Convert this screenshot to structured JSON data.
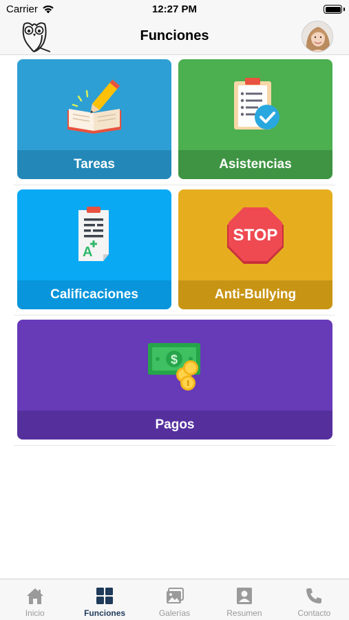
{
  "status_bar": {
    "carrier": "Carrier",
    "time": "12:27 PM"
  },
  "nav": {
    "title": "Funciones"
  },
  "tiles": [
    {
      "label": "Tareas",
      "icon": "notebook-pencil-icon"
    },
    {
      "label": "Asistencias",
      "icon": "clipboard-check-icon"
    },
    {
      "label": "Calificaciones",
      "icon": "graded-paper-icon"
    },
    {
      "label": "Anti-Bullying",
      "icon": "stop-sign-icon"
    },
    {
      "label": "Pagos",
      "icon": "money-coins-icon"
    }
  ],
  "colors": {
    "tareas": "#2e9fd4",
    "asistencias": "#4caf50",
    "calificaciones": "#09a9f4",
    "anti_bullying": "#e6ae1e",
    "pagos": "#673ab7",
    "tab_active": "#1f3a5a",
    "tab_inactive": "#999999"
  },
  "tabs": [
    {
      "label": "Inicio",
      "icon": "home-icon",
      "active": false
    },
    {
      "label": "Funciones",
      "icon": "grid-icon",
      "active": true
    },
    {
      "label": "Galerías",
      "icon": "gallery-icon",
      "active": false
    },
    {
      "label": "Resumen",
      "icon": "profile-card-icon",
      "active": false
    },
    {
      "label": "Contacto",
      "icon": "phone-icon",
      "active": false
    }
  ]
}
